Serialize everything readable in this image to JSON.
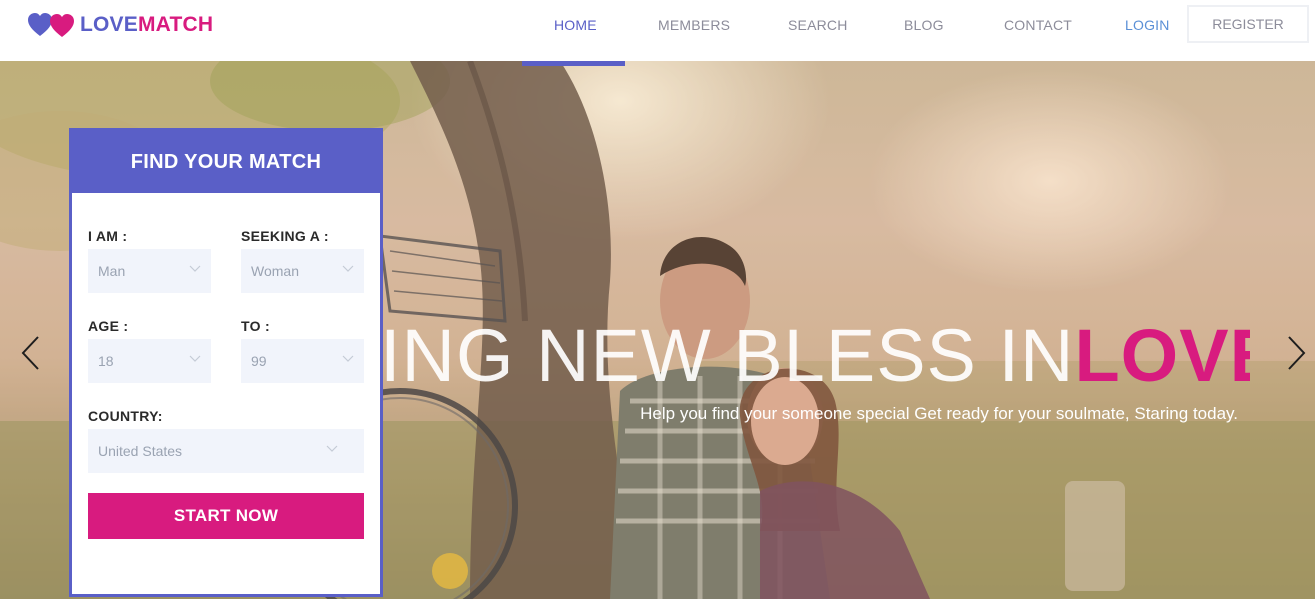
{
  "brand": {
    "logo_part1": "LOVE",
    "logo_part2": "MATCH",
    "colors": {
      "primary": "#5a5fc7",
      "accent": "#d81b7f"
    }
  },
  "nav": {
    "items": [
      {
        "label": "HOME",
        "active": true
      },
      {
        "label": "MEMBERS"
      },
      {
        "label": "SEARCH"
      },
      {
        "label": "BLOG"
      },
      {
        "label": "CONTACT"
      }
    ],
    "login": "LOGIN",
    "register": "REGISTER"
  },
  "hero": {
    "headline_light": "ING NEW BLESS IN",
    "headline_strong": "LOVE",
    "subline": "Help you find your someone special Get ready for your soulmate, Staring today.",
    "prev_icon": "chevron-left-icon",
    "next_icon": "chevron-right-icon"
  },
  "finder": {
    "title": "FIND YOUR MATCH",
    "i_am_label": "I AM :",
    "i_am_value": "Man",
    "seeking_label": "SEEKING A :",
    "seeking_value": "Woman",
    "age_label": "AGE :",
    "age_value": "18",
    "to_label": "TO :",
    "to_value": "99",
    "country_label": "COUNTRY:",
    "country_value": "United States",
    "submit": "START NOW"
  }
}
